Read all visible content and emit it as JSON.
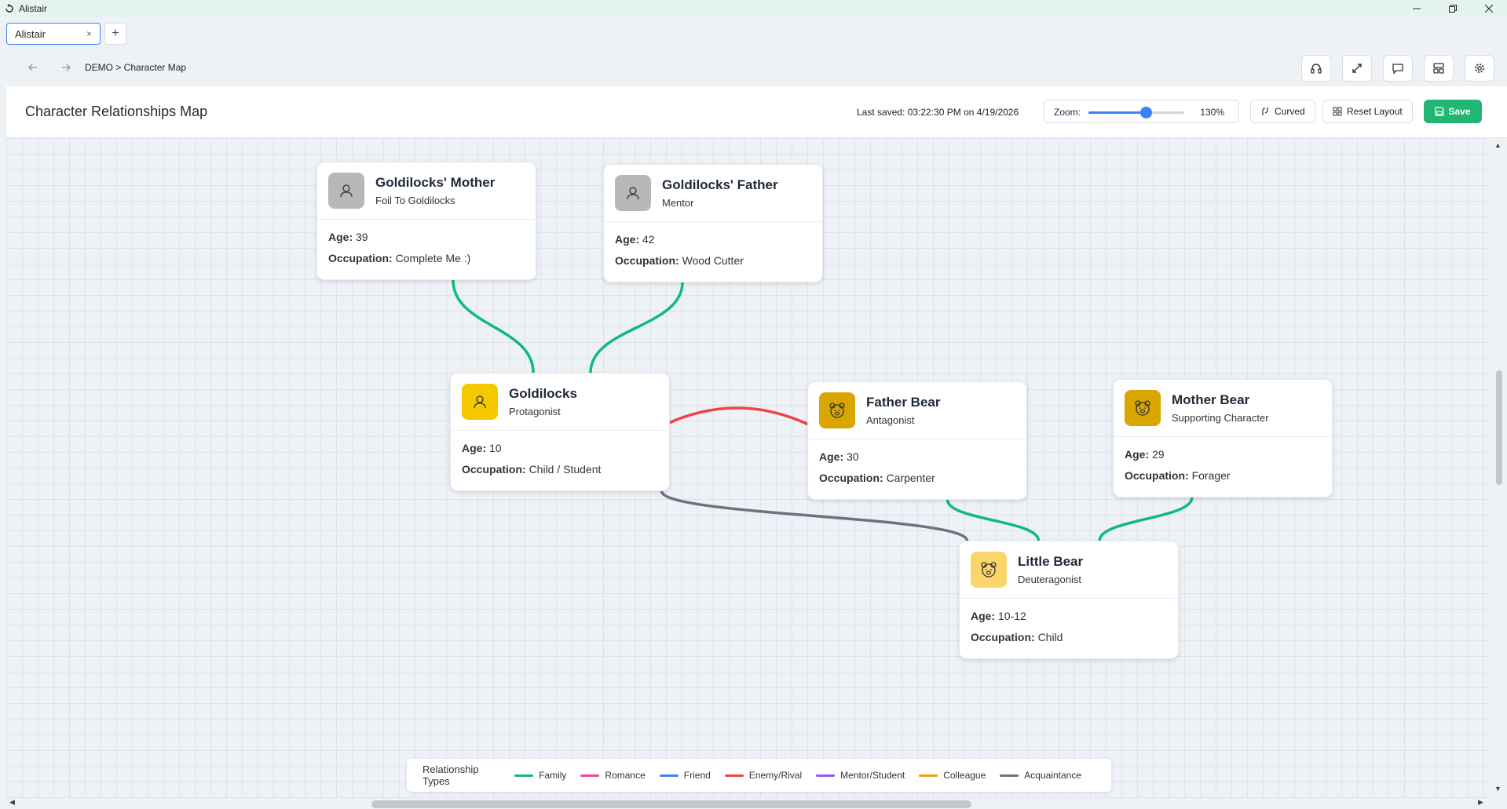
{
  "window": {
    "title": "Alistair"
  },
  "tabs": [
    {
      "label": "Alistair",
      "close": "×"
    }
  ],
  "new_tab_label": "+",
  "nav": {
    "back_icon": "arrow-left-icon",
    "forward_icon": "arrow-right-icon",
    "breadcrumb": "DEMO > Character Map"
  },
  "toolbar_icons": [
    "headphones-icon",
    "expand-icon",
    "comment-icon",
    "layout-icon",
    "gear-icon"
  ],
  "header": {
    "title": "Character Relationships Map",
    "last_saved": "Last saved: 03:22:30 PM on 4/19/2026",
    "zoom_label": "Zoom:",
    "zoom_value": "130%",
    "zoom_fraction": 0.6,
    "curved_label": "Curved",
    "reset_label": "Reset Layout",
    "save_label": "Save"
  },
  "characters": [
    {
      "id": "mother",
      "name": "Goldilocks' Mother",
      "role": "Foil To Goldilocks",
      "age_label": "Age:",
      "age": "39",
      "occ_label": "Occupation:",
      "occupation": "Complete Me :)",
      "avatar": "person-icon",
      "avatar_color": "#b8b8b8"
    },
    {
      "id": "father",
      "name": "Goldilocks' Father",
      "role": "Mentor",
      "age_label": "Age:",
      "age": "42",
      "occ_label": "Occupation:",
      "occupation": "Wood Cutter",
      "avatar": "person-icon",
      "avatar_color": "#b8b8b8"
    },
    {
      "id": "goldilocks",
      "name": "Goldilocks",
      "role": "Protagonist",
      "age_label": "Age:",
      "age": "10",
      "occ_label": "Occupation:",
      "occupation": "Child / Student",
      "avatar": "person-icon",
      "avatar_color": "#f5c800"
    },
    {
      "id": "fatherbear",
      "name": "Father Bear",
      "role": "Antagonist",
      "age_label": "Age:",
      "age": "30",
      "occ_label": "Occupation:",
      "occupation": "Carpenter",
      "avatar": "bear-icon",
      "avatar_color": "#d9a600"
    },
    {
      "id": "motherbear",
      "name": "Mother Bear",
      "role": "Supporting Character",
      "age_label": "Age:",
      "age": "29",
      "occ_label": "Occupation:",
      "occupation": "Forager",
      "avatar": "bear-icon",
      "avatar_color": "#d9a600"
    },
    {
      "id": "littlebear",
      "name": "Little Bear",
      "role": "Deuteragonist",
      "age_label": "Age:",
      "age": "10-12",
      "occ_label": "Occupation:",
      "occupation": "Child",
      "avatar": "bear-icon",
      "avatar_color": "#fbd46a"
    }
  ],
  "relationships": [
    {
      "from": "mother",
      "to": "goldilocks",
      "type": "Family"
    },
    {
      "from": "father",
      "to": "goldilocks",
      "type": "Family"
    },
    {
      "from": "goldilocks",
      "to": "fatherbear",
      "type": "Enemy/Rival"
    },
    {
      "from": "goldilocks",
      "to": "littlebear",
      "type": "Acquaintance"
    },
    {
      "from": "fatherbear",
      "to": "littlebear",
      "type": "Family"
    },
    {
      "from": "motherbear",
      "to": "littlebear",
      "type": "Family"
    }
  ],
  "legend": {
    "title": "Relationship Types",
    "items": [
      {
        "label": "Family",
        "color": "#10b981"
      },
      {
        "label": "Romance",
        "color": "#ec4899"
      },
      {
        "label": "Friend",
        "color": "#3b82f6"
      },
      {
        "label": "Enemy/Rival",
        "color": "#ef4444"
      },
      {
        "label": "Mentor/Student",
        "color": "#8b5cf6"
      },
      {
        "label": "Colleague",
        "color": "#f59e0b"
      },
      {
        "label": "Acquaintance",
        "color": "#6b7280"
      }
    ]
  }
}
